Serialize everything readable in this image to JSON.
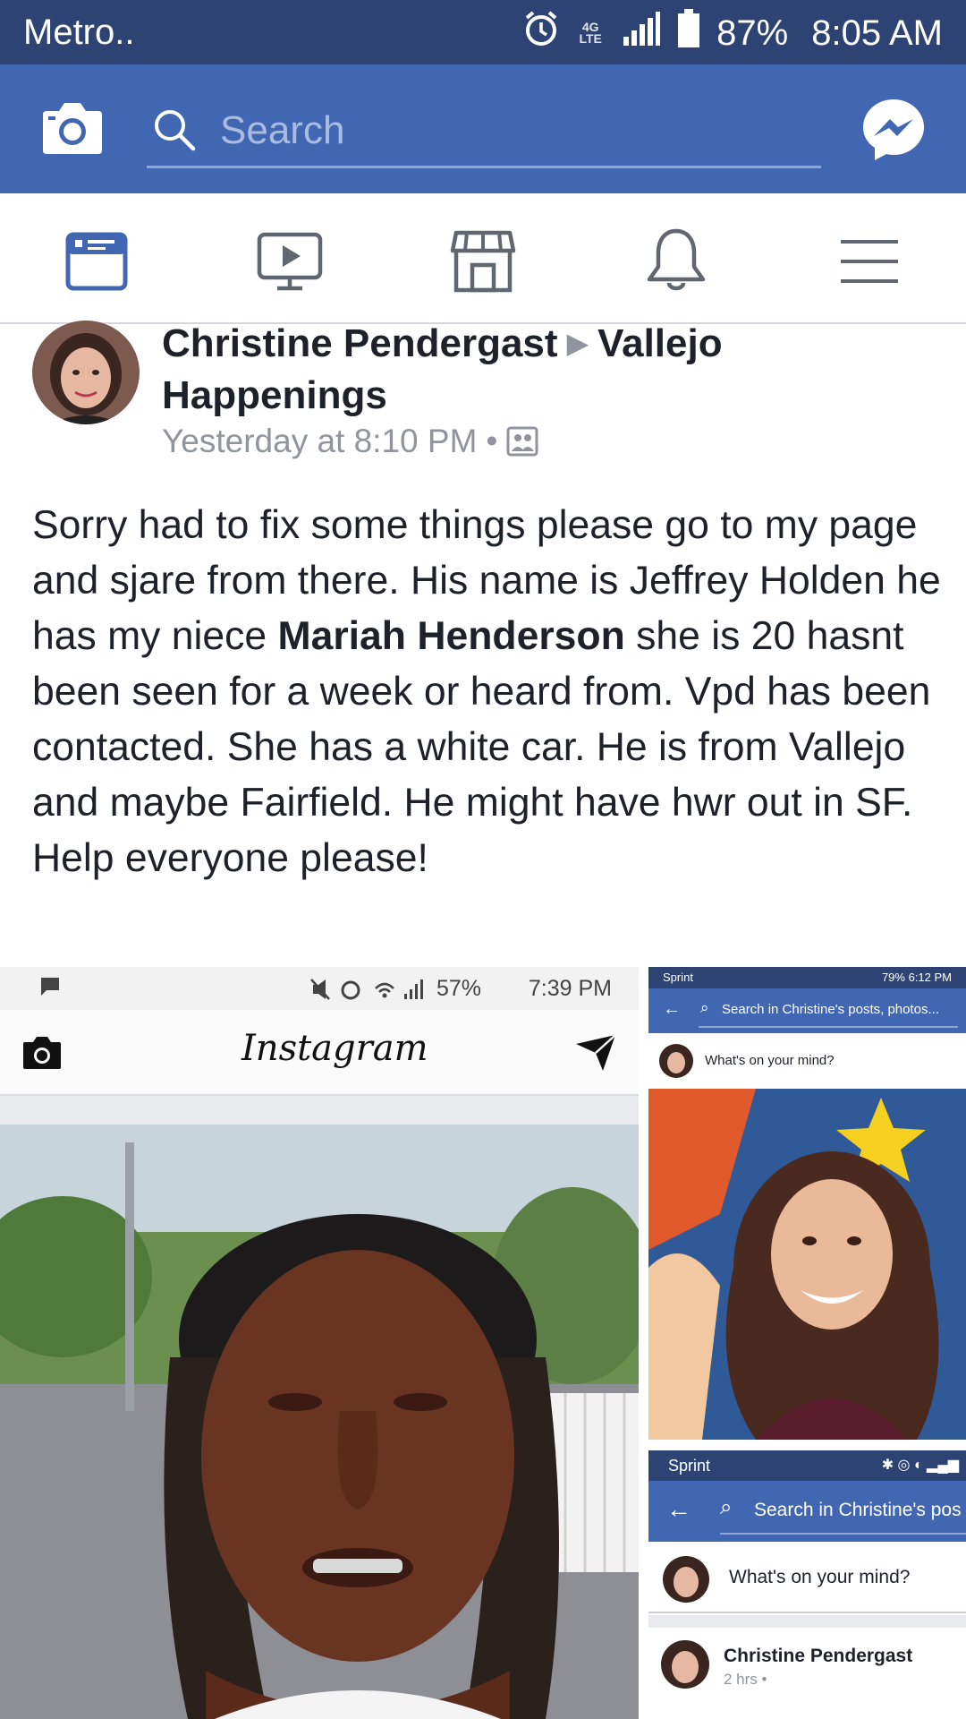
{
  "status_bar": {
    "carrier": "Metro..",
    "network": "4G LTE",
    "battery": "87%",
    "time": "8:05 AM"
  },
  "header": {
    "search_placeholder": "Search"
  },
  "nav": {
    "items": [
      "news-feed-icon",
      "watch-icon",
      "marketplace-icon",
      "notifications-icon",
      "menu-icon"
    ],
    "active": "news-feed-icon"
  },
  "post": {
    "author": "Christine Pendergast",
    "group": "Vallejo Happenings",
    "timestamp": "Yesterday at 8:10 PM",
    "separator": "•",
    "body_part1": "Sorry had to fix some things please go to my page and sjare from there.  His name is Jeffrey Holden he has my niece ",
    "tagged_name": "Mariah Henderson",
    "body_part2": " she is 20 hasnt been seen for a week or heard from.  Vpd has been contacted.  She has a white car. He is from Vallejo and maybe Fairfield.  He might have hwr out in SF.  Help everyone please!"
  },
  "photo_main": {
    "status_battery": "57%",
    "status_time": "7:39 PM",
    "app_title": "Instagram"
  },
  "photo_right_top": {
    "carrier": "Sprint",
    "status_text": "79%  6:12 PM",
    "search_text": "Search in Christine's posts, photos...",
    "composer_text": "What's on your mind?"
  },
  "photo_right_bottom": {
    "carrier": "Sprint",
    "search_text": "Search in Christine's pos",
    "composer_text": "What's on your mind?",
    "author": "Christine Pendergast",
    "time": "2 hrs •"
  },
  "colors": {
    "facebook_blue": "#4267b2",
    "status_bar": "#2d4373",
    "meta_gray": "#90949c"
  }
}
